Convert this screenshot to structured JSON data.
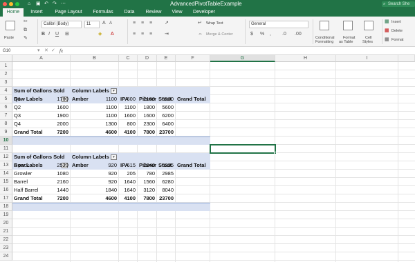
{
  "window": {
    "title": "AdvancedPivotTableExample",
    "search_placeholder": "Search She"
  },
  "tabs": [
    "Home",
    "Insert",
    "Page Layout",
    "Formulas",
    "Data",
    "Review",
    "View",
    "Developer"
  ],
  "ribbon": {
    "paste_label": "Paste",
    "font_name": "Calibri (Body)",
    "font_size": "11",
    "wrap_text": "Wrap Text",
    "merge_center": "Merge & Center",
    "number_format": "General",
    "conditional_formatting": [
      "Conditional",
      "Formatting"
    ],
    "format_as_table": [
      "Format",
      "as Table"
    ],
    "cell_styles": [
      "Cell",
      "Styles"
    ],
    "insert": "Insert",
    "delete": "Delete",
    "format": "Format"
  },
  "formula_bar": {
    "name_box": "G10",
    "fx": "fx",
    "value": ""
  },
  "columns": [
    "A",
    "B",
    "C",
    "D",
    "E",
    "F",
    "G",
    "H",
    "I"
  ],
  "rows": [
    "1",
    "2",
    "3",
    "4",
    "5",
    "6",
    "7",
    "8",
    "9",
    "10",
    "11",
    "12",
    "13",
    "14",
    "15",
    "16",
    "17",
    "18",
    "19",
    "20",
    "21",
    "22",
    "23",
    "24"
  ],
  "pivot1": {
    "value_field": "Sum of Gallons Sold",
    "column_labels": "Column Labels",
    "row_labels": "Row Labels",
    "headers": [
      "Amber",
      "IPA",
      "Pilsner",
      "Stout",
      "Grand Total"
    ],
    "rows": [
      {
        "label": "Q1",
        "values": [
          "1700",
          "1100",
          "600",
          "2100",
          "5500"
        ]
      },
      {
        "label": "Q2",
        "values": [
          "1600",
          "1100",
          "1100",
          "1800",
          "5600"
        ]
      },
      {
        "label": "Q3",
        "values": [
          "1900",
          "1100",
          "1600",
          "1600",
          "6200"
        ]
      },
      {
        "label": "Q4",
        "values": [
          "2000",
          "1300",
          "800",
          "2300",
          "6400"
        ]
      }
    ],
    "total": {
      "label": "Grand Total",
      "values": [
        "7200",
        "4600",
        "4100",
        "7800",
        "23700"
      ]
    }
  },
  "pivot2": {
    "value_field": "Sum of Gallons Sold",
    "column_labels": "Column Labels",
    "row_labels": "Row Labels",
    "headers": [
      "Amber",
      "IPA",
      "Pilsner",
      "Stout",
      "Grand Total"
    ],
    "rows": [
      {
        "label": "6 pack",
        "values": [
          "2520",
          "920",
          "615",
          "2340",
          "6395"
        ]
      },
      {
        "label": "Growler",
        "values": [
          "1080",
          "920",
          "205",
          "780",
          "2985"
        ]
      },
      {
        "label": "Barrel",
        "values": [
          "2160",
          "920",
          "1640",
          "1560",
          "6280"
        ]
      },
      {
        "label": "Half Barrel",
        "values": [
          "1440",
          "1840",
          "1640",
          "3120",
          "8040"
        ]
      }
    ],
    "total": {
      "label": "Grand Total",
      "values": [
        "7200",
        "4600",
        "4100",
        "7800",
        "23700"
      ]
    }
  },
  "colors": {
    "accent": "#217346",
    "pivot_band": "#d9e1f2"
  }
}
